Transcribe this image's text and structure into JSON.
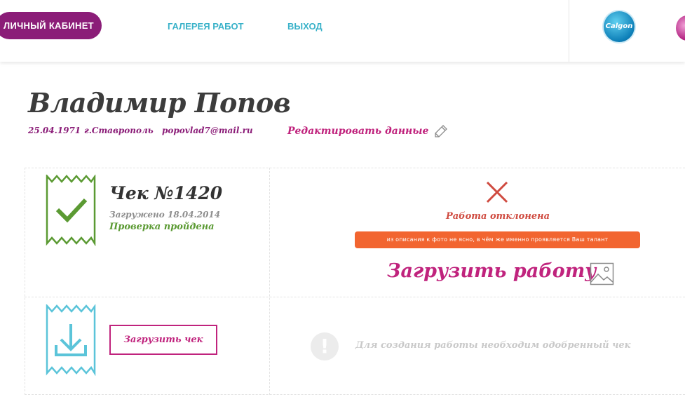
{
  "header": {
    "nav": {
      "cabinet": "ЛИЧНЫЙ КАБИНЕТ",
      "gallery": "ГАЛЕРЕЯ РАБОТ",
      "logout": "ВЫХОД"
    },
    "logo_text": "Calgon"
  },
  "profile": {
    "name": "Владимир Попов",
    "birth_date": "25.04.1971",
    "city": "г.Ставрополь",
    "email": "popovlad7@mail.ru",
    "edit_label": "Редактировать данные"
  },
  "receipt": {
    "title": "Чек №1420",
    "uploaded": "Загружено 18.04.2014",
    "status": "Проверка пройдена",
    "work_status": "Работа отклонена",
    "reject_reason": "из описания к фото не ясно, в чём же именно проявляется Ваш талант",
    "upload_work_label": "Загрузить работу"
  },
  "new_receipt": {
    "upload_label": "Загрузить чек",
    "notice": "Для создания работы необходим одобренный чек"
  },
  "icons": {
    "check": "checkmark-icon",
    "reject": "close-icon",
    "edit": "pencil-icon",
    "image": "image-icon",
    "download": "download-icon",
    "notice": "exclamation-icon"
  },
  "colors": {
    "brand_purple": "#8b1d78",
    "accent_pink": "#c0237d",
    "nav_blue": "#3ab2c9",
    "success_green": "#5b9a33",
    "reject_red": "#cf4a3f",
    "reject_badge": "#f26530"
  }
}
